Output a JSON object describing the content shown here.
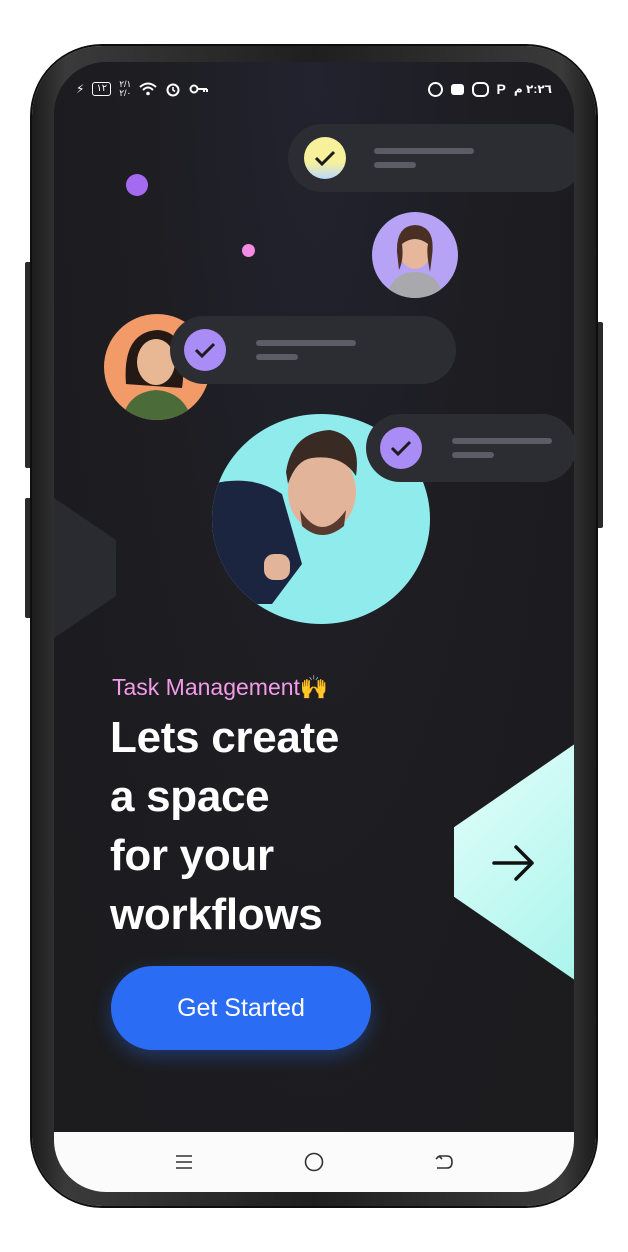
{
  "status_bar": {
    "battery": "١٢",
    "sim_text": "٢/١\n٢/٠",
    "time": "٢:٢٦ م",
    "left_icons": [
      "charging-icon",
      "battery-icon",
      "signal-icon",
      "wifi-icon",
      "alarm-icon",
      "key-icon"
    ],
    "right_icons": [
      "app-notification-icon",
      "app-notification-icon",
      "app-notification-icon",
      "parking-icon"
    ]
  },
  "hero": {
    "tagline": "Task Management🙌",
    "headline_lines": [
      "Lets create",
      "a space",
      "for your",
      "workflows"
    ]
  },
  "cta": {
    "label": "Get Started"
  },
  "colors": {
    "background": "#1c1c1e",
    "accent_blue": "#2a6df4",
    "pink": "#f39be8",
    "teal": "#9ff3ea",
    "purple": "#a98cf5",
    "yellow": "#f4f09a"
  },
  "nav_icons": [
    "menu-icon",
    "home-circle-icon",
    "back-icon"
  ]
}
